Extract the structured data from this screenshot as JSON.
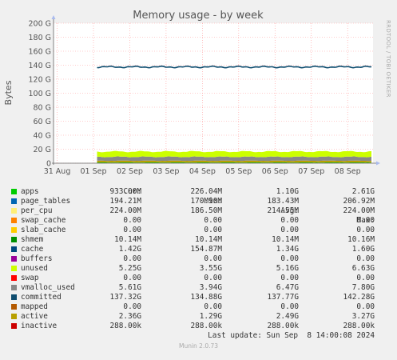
{
  "chart_data": {
    "type": "area",
    "title": "Memory usage - by week",
    "ylabel": "Bytes",
    "side_label": "RRDTOOL / TOBI OETIKER",
    "ylim": [
      0,
      200
    ],
    "y_unit": "G",
    "y_ticks": [
      "0",
      "20 G",
      "40 G",
      "60 G",
      "80 G",
      "100 G",
      "120 G",
      "140 G",
      "160 G",
      "180 G",
      "200 G"
    ],
    "x_ticks": [
      "31 Aug",
      "01 Sep",
      "02 Sep",
      "03 Sep",
      "04 Sep",
      "05 Sep",
      "06 Sep",
      "07 Sep",
      "08 Sep"
    ],
    "data_start_day": 1.1,
    "series": [
      {
        "name": "committed",
        "color": "#0f4d6f",
        "style": "line",
        "approx_value": 137.5
      },
      {
        "name": "unused",
        "color": "#ccff00",
        "style": "area",
        "approx_value": 7.5
      },
      {
        "name": "vmalloc_used",
        "color": "#888888",
        "style": "area",
        "approx_value": 5.6
      },
      {
        "name": "active",
        "color": "#b8a000",
        "style": "area",
        "approx_value": 2.4
      },
      {
        "name": "apps",
        "color": "#00cc00",
        "style": "area",
        "approx_value": 0.9
      },
      {
        "name": "per_cpu",
        "color": "#ffee77",
        "style": "area",
        "approx_value": 0.2
      }
    ]
  },
  "legend": {
    "headers": [
      "Cur:",
      "Min:",
      "Avg:",
      "Max:"
    ],
    "rows": [
      {
        "name": "apps",
        "color": "#00cc00",
        "cur": "933.00M",
        "min": "226.04M",
        "avg": "1.10G",
        "max": "2.61G"
      },
      {
        "name": "page_tables",
        "color": "#0066b3",
        "cur": "194.21M",
        "min": "170.90M",
        "avg": "183.43M",
        "max": "206.92M"
      },
      {
        "name": "per_cpu",
        "color": "#ffee77",
        "cur": "224.00M",
        "min": "186.50M",
        "avg": "214.55M",
        "max": "224.00M"
      },
      {
        "name": "swap_cache",
        "color": "#ff8000",
        "cur": "0.00",
        "min": "0.00",
        "avg": "0.00",
        "max": "0.00"
      },
      {
        "name": "slab_cache",
        "color": "#ffcc00",
        "cur": "0.00",
        "min": "0.00",
        "avg": "0.00",
        "max": "0.00"
      },
      {
        "name": "shmem",
        "color": "#008f00",
        "cur": "10.14M",
        "min": "10.14M",
        "avg": "10.14M",
        "max": "10.16M"
      },
      {
        "name": "cache",
        "color": "#00487d",
        "cur": "1.42G",
        "min": "154.87M",
        "avg": "1.34G",
        "max": "1.60G"
      },
      {
        "name": "buffers",
        "color": "#990099",
        "cur": "0.00",
        "min": "0.00",
        "avg": "0.00",
        "max": "0.00"
      },
      {
        "name": "unused",
        "color": "#ccff00",
        "cur": "5.25G",
        "min": "3.55G",
        "avg": "5.16G",
        "max": "6.63G"
      },
      {
        "name": "swap",
        "color": "#ff0000",
        "cur": "0.00",
        "min": "0.00",
        "avg": "0.00",
        "max": "0.00"
      },
      {
        "name": "vmalloc_used",
        "color": "#888888",
        "cur": "5.61G",
        "min": "3.94G",
        "avg": "6.47G",
        "max": "7.80G"
      },
      {
        "name": "committed",
        "color": "#0f4d6f",
        "cur": "137.32G",
        "min": "134.88G",
        "avg": "137.77G",
        "max": "142.28G"
      },
      {
        "name": "mapped",
        "color": "#b35900",
        "cur": "0.00",
        "min": "0.00",
        "avg": "0.00",
        "max": "0.00"
      },
      {
        "name": "active",
        "color": "#b8a000",
        "cur": "2.36G",
        "min": "1.29G",
        "avg": "2.49G",
        "max": "3.27G"
      },
      {
        "name": "inactive",
        "color": "#cc0000",
        "cur": "288.00k",
        "min": "288.00k",
        "avg": "288.00k",
        "max": "288.00k"
      }
    ],
    "last_update": "Last update: Sun Sep  8 14:00:08 2024"
  },
  "footer": "Munin 2.0.73"
}
